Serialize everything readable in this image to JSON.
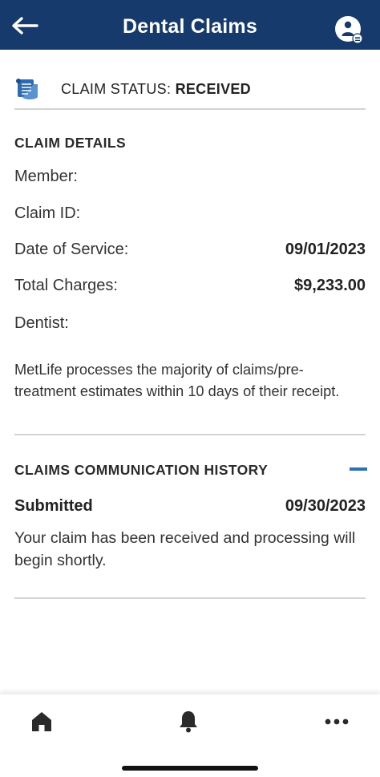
{
  "header": {
    "title": "Dental Claims",
    "back_icon": "arrow-left-icon",
    "profile_icon": "user-profile-icon",
    "background_color": "#153a6b"
  },
  "status": {
    "icon": "document-scroll-icon",
    "label": "CLAIM STATUS:",
    "value": "RECEIVED"
  },
  "claim_details": {
    "heading": "CLAIM DETAILS",
    "rows": [
      {
        "label": "Member:",
        "value": ""
      },
      {
        "label": "Claim ID:",
        "value": ""
      },
      {
        "label": "Date of Service:",
        "value": "09/01/2023"
      },
      {
        "label": "Total Charges:",
        "value": "$9,233.00"
      },
      {
        "label": "Dentist:",
        "value": ""
      }
    ],
    "note": "MetLife processes the majority of claims/pre-treatment estimates within 10 days of their receipt."
  },
  "communication_history": {
    "heading": "CLAIMS COMMUNICATION HISTORY",
    "collapse_icon": "minus-icon",
    "entries": [
      {
        "status": "Submitted",
        "date": "09/30/2023",
        "message": "Your claim has been received and processing will begin shortly."
      }
    ]
  },
  "tabbar": {
    "items": [
      {
        "icon": "home-icon"
      },
      {
        "icon": "bell-icon"
      },
      {
        "icon": "more-dots-icon"
      }
    ]
  },
  "colors": {
    "accent": "#2d6fb3",
    "status_icon": "#2f6bb0",
    "divider": "#d3d3d3"
  }
}
